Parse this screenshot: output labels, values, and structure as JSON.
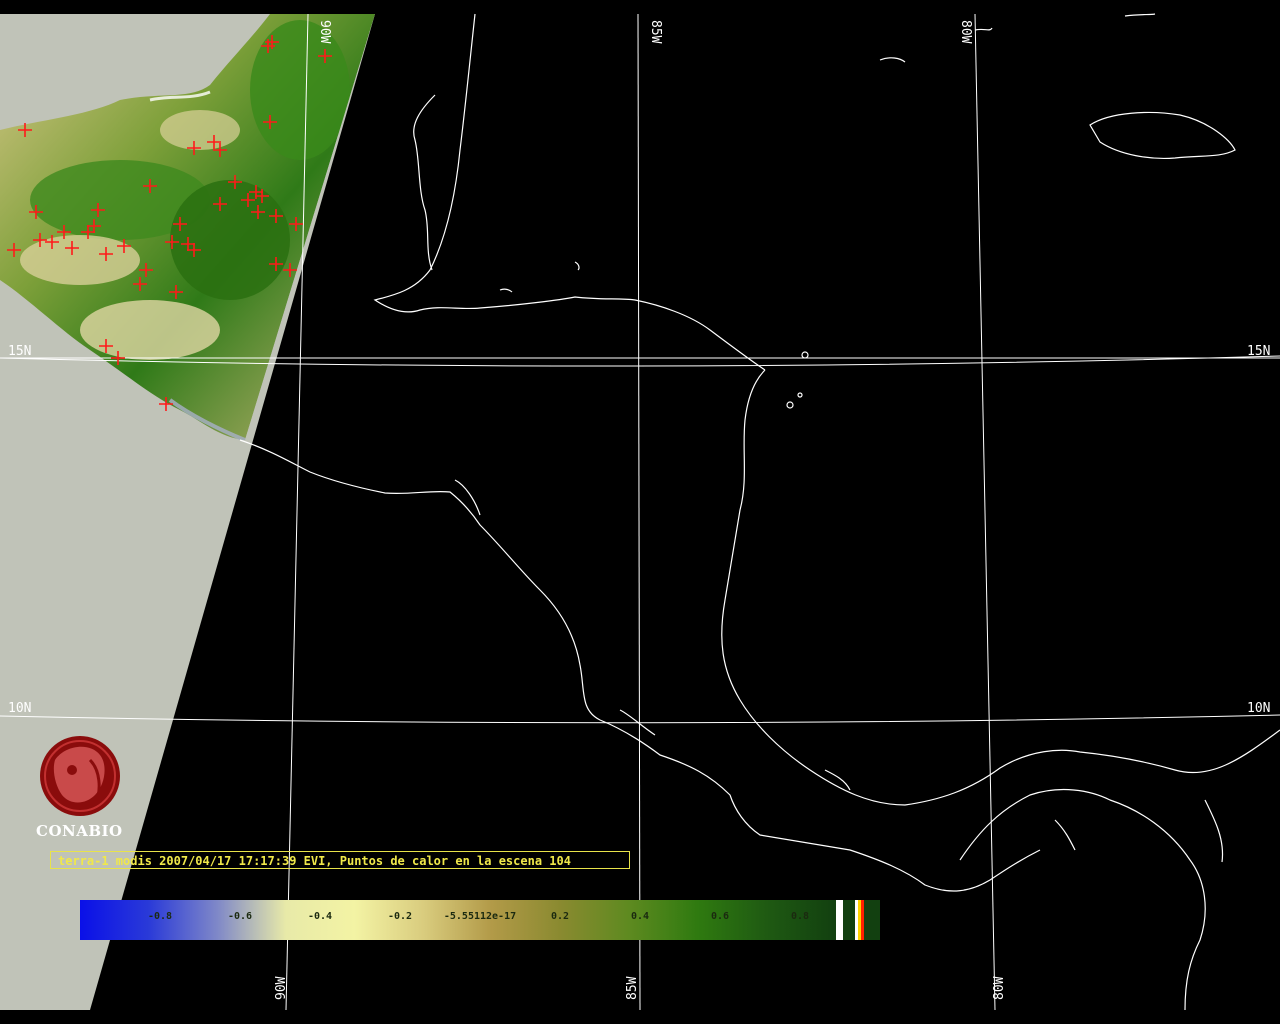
{
  "map": {
    "logo_text": "CONABIO",
    "caption": "terra-1 modis 2007/04/17 17:17:39 EVI, Puntos de calor en la escena 104",
    "grid_labels": {
      "lon_90w": "90W",
      "lon_85w": "85W",
      "lon_80w": "80W",
      "lat_15n": "15N",
      "lat_10n": "10N"
    },
    "colorbar": {
      "tick_labels": [
        "-0.8",
        "-0.6",
        "-0.4",
        "-0.2",
        "-5.55112e-17",
        "0.2",
        "0.4",
        "0.6",
        "0.8"
      ],
      "colors": [
        "#0a10e8",
        "#2a3ad8",
        "#7f88c8",
        "#e8eaa8",
        "#f3f3a4",
        "#d9cc7e",
        "#b29a48",
        "#8a8a30",
        "#5e8a20",
        "#2f7a10",
        "#1f5a12",
        "#124010"
      ],
      "fire_colors": [
        "#ffffff",
        "#ffd400",
        "#ff2000"
      ]
    },
    "hotspot_color": "#ff1a1a",
    "coastline_color": "#ffffff",
    "nodata_color": "#c0c3b8"
  }
}
